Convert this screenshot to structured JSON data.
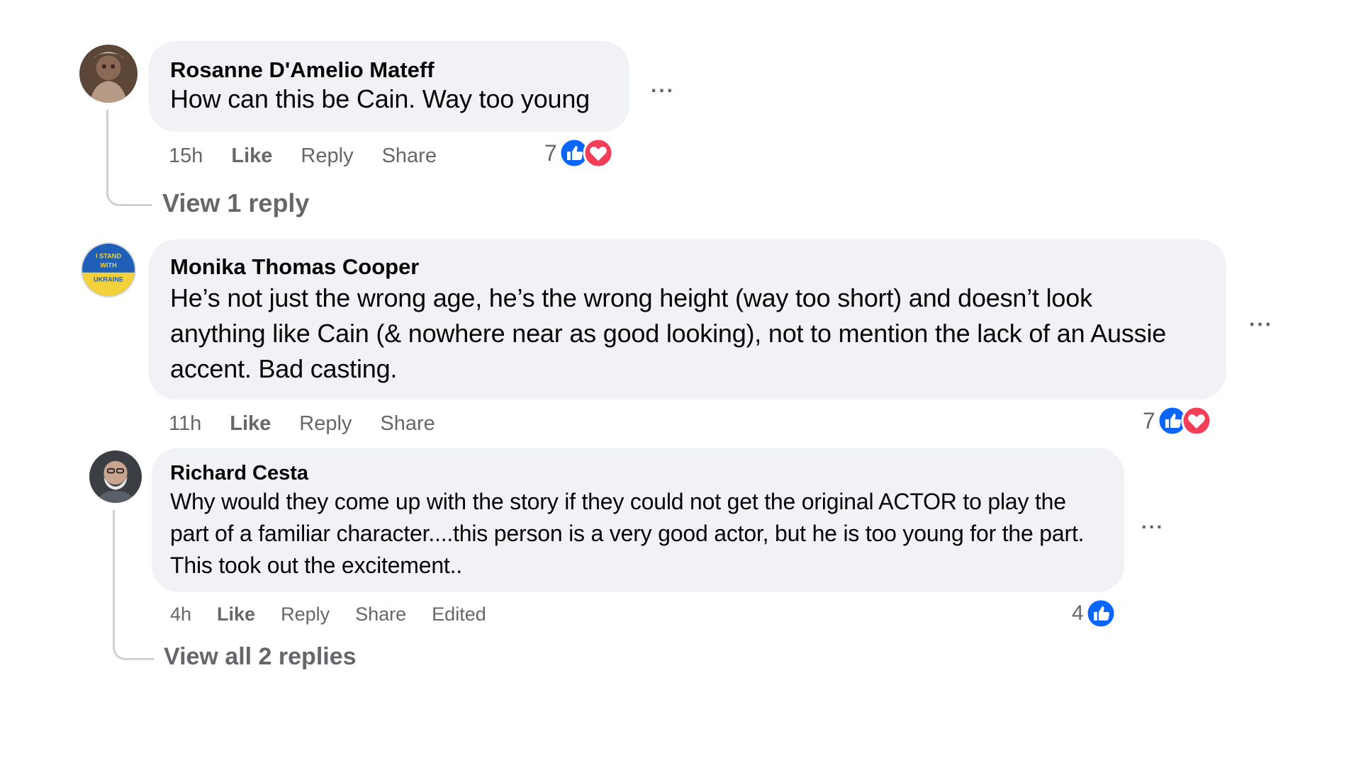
{
  "comments": [
    {
      "author": "Rosanne D'Amelio Mateff",
      "text": "How can this be Cain. Way too young",
      "time": "15h",
      "like_label": "Like",
      "reply_label": "Reply",
      "share_label": "Share",
      "reaction_count": "7",
      "reactions": [
        "like-icon",
        "love-icon"
      ],
      "more_label": "...",
      "view_replies": "View 1 reply"
    },
    {
      "author": "Monika Thomas Cooper",
      "text": "He’s not just the wrong age, he’s the wrong height (way too short) and doesn’t look anything like Cain (& nowhere near as good looking), not to mention the lack of an Aussie accent. Bad casting.",
      "time": "11h",
      "like_label": "Like",
      "reply_label": "Reply",
      "share_label": "Share",
      "reaction_count": "7",
      "reactions": [
        "like-icon",
        "love-icon"
      ],
      "more_label": "..."
    },
    {
      "author": "Richard Cesta",
      "text": "Why would they come up with the story if they could not get the original ACTOR to play the part of a familiar character....this person is a very good actor, but he is too young for the part. This took out the excitement..",
      "time": "4h",
      "like_label": "Like",
      "reply_label": "Reply",
      "share_label": "Share",
      "edited_label": "Edited",
      "reaction_count": "4",
      "reactions": [
        "like-icon"
      ],
      "more_label": "...",
      "view_replies": "View all 2 replies"
    }
  ],
  "colors": {
    "bubble": "#f0f2f5",
    "meta": "#65676b",
    "like_blue": "#0866ff",
    "love_red": "#f33e58",
    "thread_line": "#ced0d4"
  }
}
